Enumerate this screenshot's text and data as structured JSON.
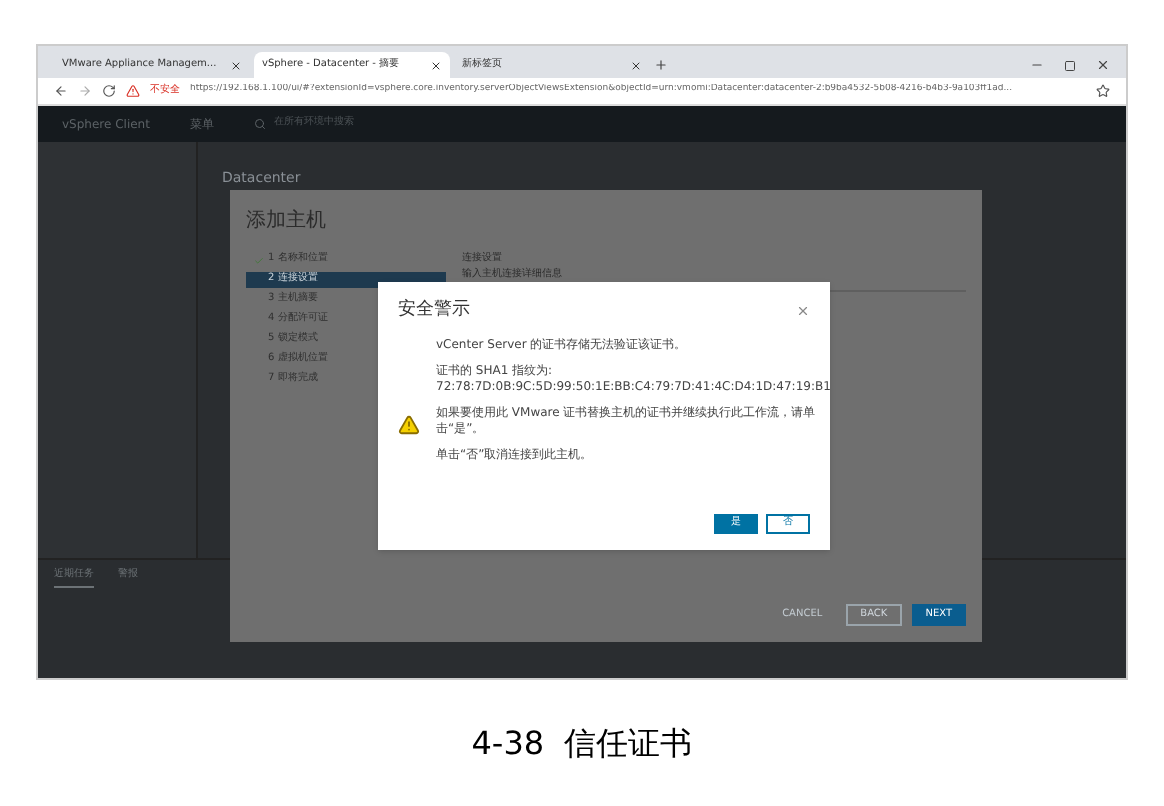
{
  "browser": {
    "tabs": [
      {
        "title": "VMware Appliance Managem...",
        "selected": false
      },
      {
        "title": "vSphere - Datacenter - 摘要",
        "selected": true
      },
      {
        "title": "新标签页",
        "selected": false
      }
    ],
    "security_label": "不安全",
    "url": "https://192.168.1.100/ui/#?extensionId=vsphere.core.inventory.serverObjectViewsExtension&objectId=urn:vmomi:Datacenter:datacenter-2:b9ba4532-5b08-4216-b4b3-9a103ff1ad..."
  },
  "app_header": {
    "title": "vSphere Client",
    "menu": "菜单",
    "search": "在所有环境中搜索"
  },
  "inventory": {
    "title": "Datacenter",
    "bottom_tabs": [
      {
        "label": "近期任务",
        "selected": true
      },
      {
        "label": "警报",
        "selected": false
      }
    ]
  },
  "wizard": {
    "title": "添加主机",
    "steps": [
      {
        "label": "1 名称和位置",
        "done": true,
        "selected": false
      },
      {
        "label": "2 连接设置",
        "done": false,
        "selected": true
      },
      {
        "label": "3 主机摘要",
        "done": false,
        "selected": false
      },
      {
        "label": "4 分配许可证",
        "done": false,
        "selected": false
      },
      {
        "label": "5 锁定模式",
        "done": false,
        "selected": false
      },
      {
        "label": "6 虚拟机位置",
        "done": false,
        "selected": false
      },
      {
        "label": "7 即将完成",
        "done": false,
        "selected": false
      }
    ],
    "section_title": "连接设置",
    "section_subtitle": "输入主机连接详细信息",
    "buttons": [
      {
        "label": "CANCEL",
        "kind": "flat"
      },
      {
        "label": "BACK",
        "kind": "outline"
      },
      {
        "label": "NEXT",
        "kind": "primary"
      }
    ]
  },
  "alert": {
    "title": "安全警示",
    "paragraphs": [
      "vCenter Server 的证书存储无法验证该证书。",
      "证书的 SHA1 指纹为:\n72:78:7D:0B:9C:5D:99:50:1E:BB:C4:79:7D:41:4C:D4:1D:47:19:B1",
      "如果要使用此 VMware 证书替换主机的证书并继续执行此工作流，请单击“是”。",
      "单击“否”取消连接到此主机。"
    ],
    "buttons": [
      {
        "label": "是",
        "kind": "primary"
      },
      {
        "label": "否",
        "kind": "outline"
      }
    ]
  },
  "caption": "4-38  信任证书"
}
